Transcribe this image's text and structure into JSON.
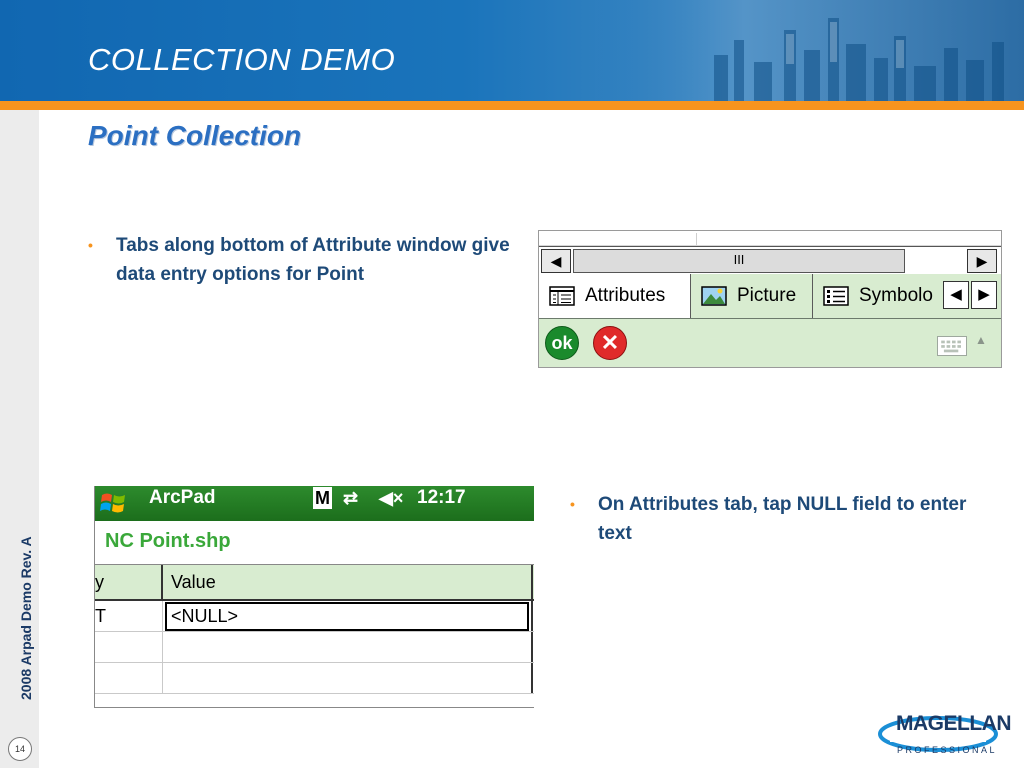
{
  "header": {
    "title": "COLLECTION DEMO"
  },
  "subtitle": "Point Collection",
  "footer": {
    "vertical_text": "2008 Arpad Demo Rev. A",
    "page_number": "14"
  },
  "bullets": [
    {
      "marker": "•",
      "text": "Tabs along bottom of Attribute window give data entry options for Point"
    },
    {
      "marker": "•",
      "text": "On Attributes tab, tap NULL field to enter text"
    }
  ],
  "attributes_window": {
    "scrollbar": {
      "left_arrow": "◀",
      "thumb": "III",
      "right_arrow": "▶"
    },
    "tabs": [
      {
        "label": "Attributes",
        "icon": "table-icon",
        "active": true
      },
      {
        "label": "Picture",
        "icon": "picture-icon",
        "active": false
      },
      {
        "label": "Symbolo",
        "icon": "list-icon",
        "active": false
      }
    ],
    "tab_nav": {
      "prev": "◀",
      "next": "▶"
    },
    "buttons": {
      "ok": "ok",
      "cancel": "✕"
    },
    "keyboard_caret": "▲"
  },
  "arcpad": {
    "app_name": "ArcPad",
    "status_icons": {
      "m": "M",
      "sync": "⇄",
      "volume": "◀×"
    },
    "time": "12:17",
    "file_name": "NC Point.shp",
    "columns": [
      "y",
      "Value"
    ],
    "rows": [
      {
        "key": "T",
        "value": "<NULL>"
      },
      {
        "key": "",
        "value": ""
      },
      {
        "key": "",
        "value": ""
      }
    ]
  },
  "logo": {
    "name": "MAGELLAN",
    "tagline": "PROFESSIONAL"
  },
  "colors": {
    "banner_blue": "#1167b1",
    "accent_orange": "#f7941e",
    "text_navy": "#1e4a78",
    "ui_green": "#d8ecd0"
  }
}
